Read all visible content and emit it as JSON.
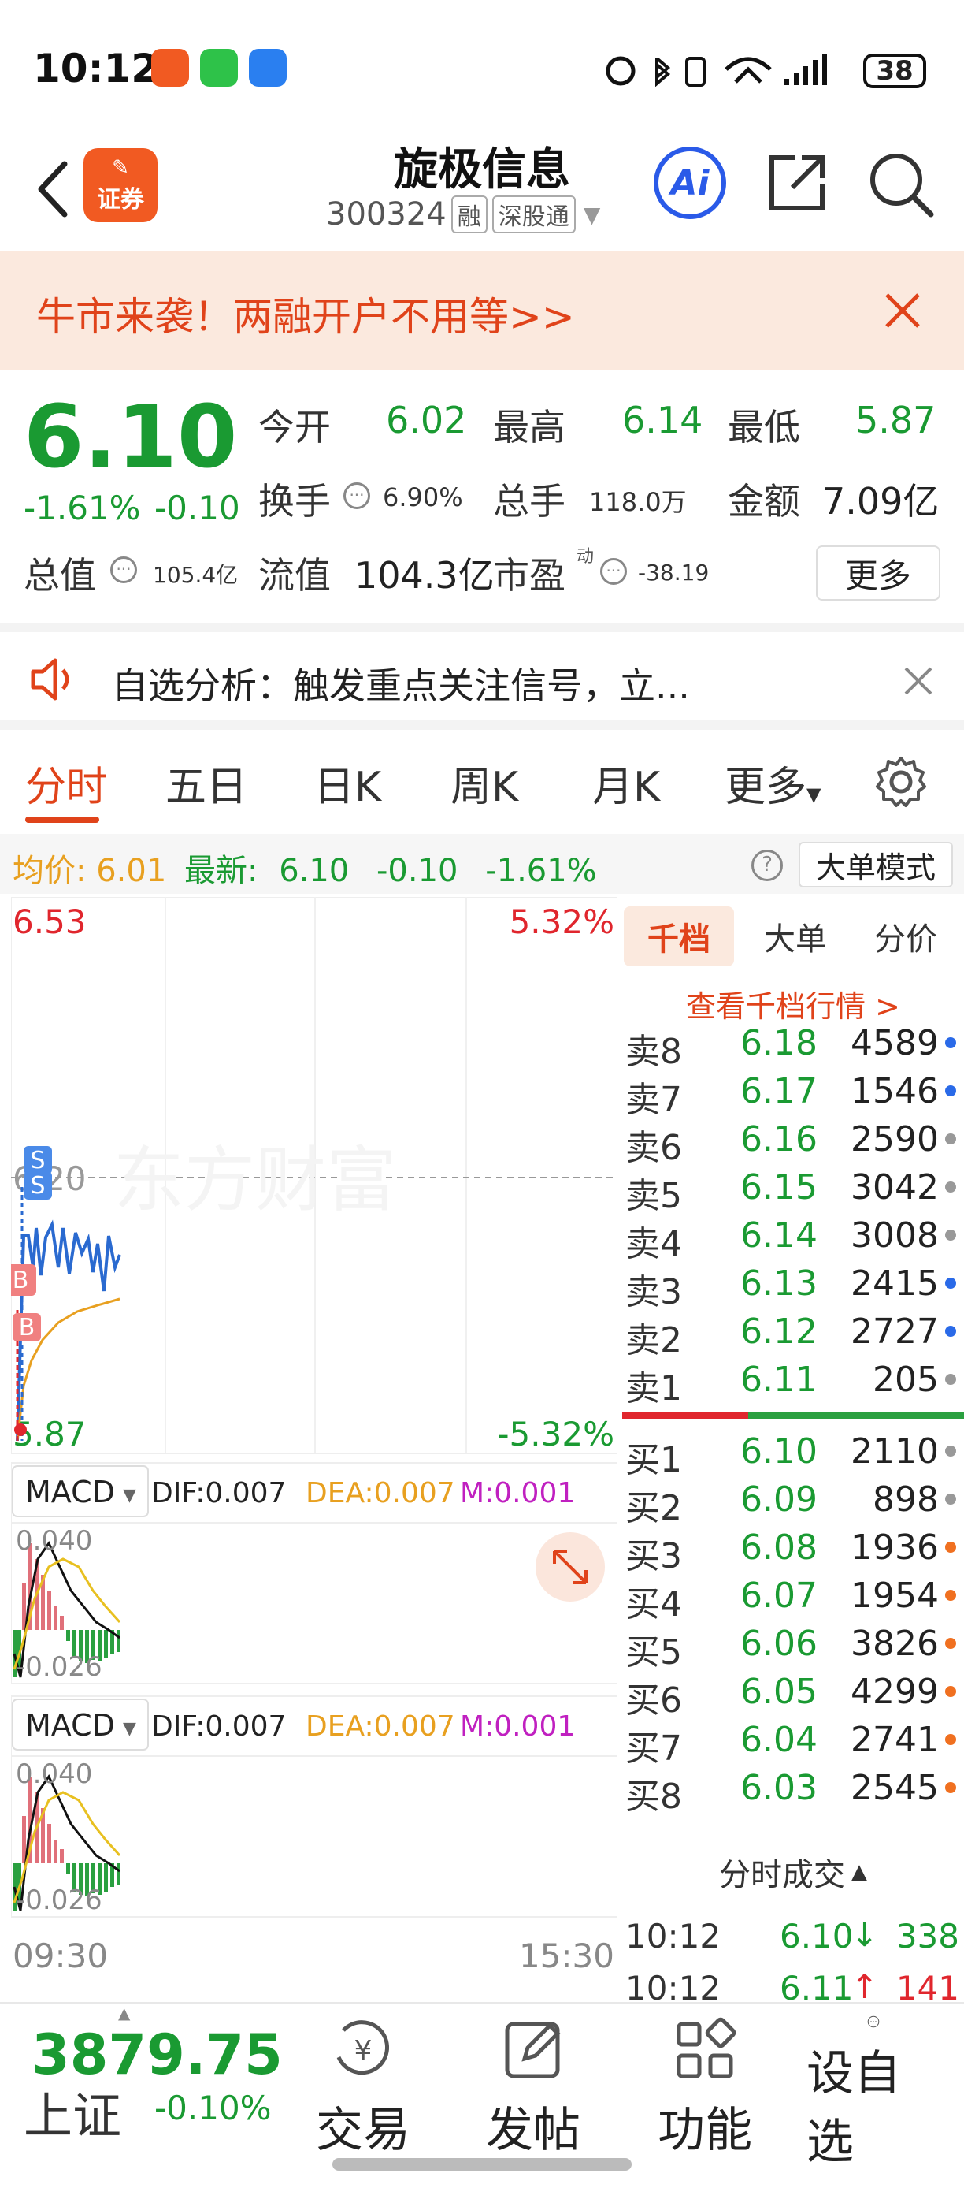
{
  "status": {
    "time": "10:12",
    "battery": "38"
  },
  "header": {
    "title": "旋极信息",
    "code": "300324",
    "tag_rong": "融",
    "tag_sgt": "深股通",
    "logo_text": "证券",
    "ai_label": "Ai"
  },
  "promo": {
    "text": "牛市来袭！两融开户不用等>>"
  },
  "quote": {
    "price": "6.10",
    "pct": "-1.61%",
    "chg": "-0.10",
    "open_label": "今开",
    "open": "6.02",
    "high_label": "最高",
    "high": "6.14",
    "low_label": "最低",
    "low": "5.87",
    "turnover_label": "换手",
    "turnover": "6.90%",
    "volume_label": "总手",
    "volume": "118.0万",
    "amount_label": "金额",
    "amount": "7.09亿",
    "mcap_label": "总值",
    "mcap": "105.4亿",
    "float_label": "流值",
    "float": "104.3亿",
    "pe_label": "市盈",
    "pe_sup": "动",
    "pe": "-38.19",
    "more": "更多"
  },
  "alert": {
    "text": "自选分析：触发重点关注信号，立..."
  },
  "tabs": [
    "分时",
    "五日",
    "日K",
    "周K",
    "月K",
    "更多"
  ],
  "avg": {
    "avg_label": "均价:",
    "avg": "6.01",
    "last_label": "最新:",
    "last": "6.10",
    "chg": "-0.10",
    "pct": "-1.61%",
    "mode": "大单模式"
  },
  "chart": {
    "top_price": "6.53",
    "top_pct": "5.32%",
    "mid_price": "6.20",
    "bot_price": "5.87",
    "bot_pct": "-5.32%",
    "watermark": "东方财富",
    "macd_label": "MACD",
    "dif": "DIF:0.007",
    "dea": "DEA:0.007",
    "m": "M:0.001",
    "macd_top": "0.040",
    "macd_bot": "-0.026",
    "time_start": "09:30",
    "time_end": "15:30",
    "signal_s": "S",
    "signal_b": "B"
  },
  "book": {
    "tabs": [
      "千档",
      "大单",
      "分价"
    ],
    "look": "查看千档行情 >",
    "sell": [
      {
        "label": "卖8",
        "price": "6.18",
        "vol": "4589",
        "dot": "#2a6ae8"
      },
      {
        "label": "卖7",
        "price": "6.17",
        "vol": "1546",
        "dot": "#2a6ae8"
      },
      {
        "label": "卖6",
        "price": "6.16",
        "vol": "2590",
        "dot": "#999999"
      },
      {
        "label": "卖5",
        "price": "6.15",
        "vol": "3042",
        "dot": "#999999"
      },
      {
        "label": "卖4",
        "price": "6.14",
        "vol": "3008",
        "dot": "#999999"
      },
      {
        "label": "卖3",
        "price": "6.13",
        "vol": "2415",
        "dot": "#2a6ae8"
      },
      {
        "label": "卖2",
        "price": "6.12",
        "vol": "2727",
        "dot": "#2a6ae8"
      },
      {
        "label": "卖1",
        "price": "6.11",
        "vol": "205",
        "dot": "#999999"
      }
    ],
    "buy": [
      {
        "label": "买1",
        "price": "6.10",
        "vol": "2110",
        "dot": "#999999"
      },
      {
        "label": "买2",
        "price": "6.09",
        "vol": "898",
        "dot": "#999999"
      },
      {
        "label": "买3",
        "price": "6.08",
        "vol": "1936",
        "dot": "#f07020"
      },
      {
        "label": "买4",
        "price": "6.07",
        "vol": "1954",
        "dot": "#f07020"
      },
      {
        "label": "买5",
        "price": "6.06",
        "vol": "3826",
        "dot": "#f07020"
      },
      {
        "label": "买6",
        "price": "6.05",
        "vol": "4299",
        "dot": "#f07020"
      },
      {
        "label": "买7",
        "price": "6.04",
        "vol": "2741",
        "dot": "#f07020"
      },
      {
        "label": "买8",
        "price": "6.03",
        "vol": "2545",
        "dot": "#f07020"
      }
    ],
    "trades_title": "分时成交",
    "trades": [
      {
        "time": "10:12",
        "price": "6.10",
        "arrow": "↓",
        "vol": "338",
        "dir": "down"
      },
      {
        "time": "10:12",
        "price": "6.11",
        "arrow": "↑",
        "vol": "141",
        "dir": "up"
      }
    ]
  },
  "bottom": {
    "index_value": "3879.75",
    "index_name": "上证",
    "index_chg": "-0.10%",
    "nav": [
      "交易",
      "发帖",
      "功能",
      "设自选"
    ]
  }
}
